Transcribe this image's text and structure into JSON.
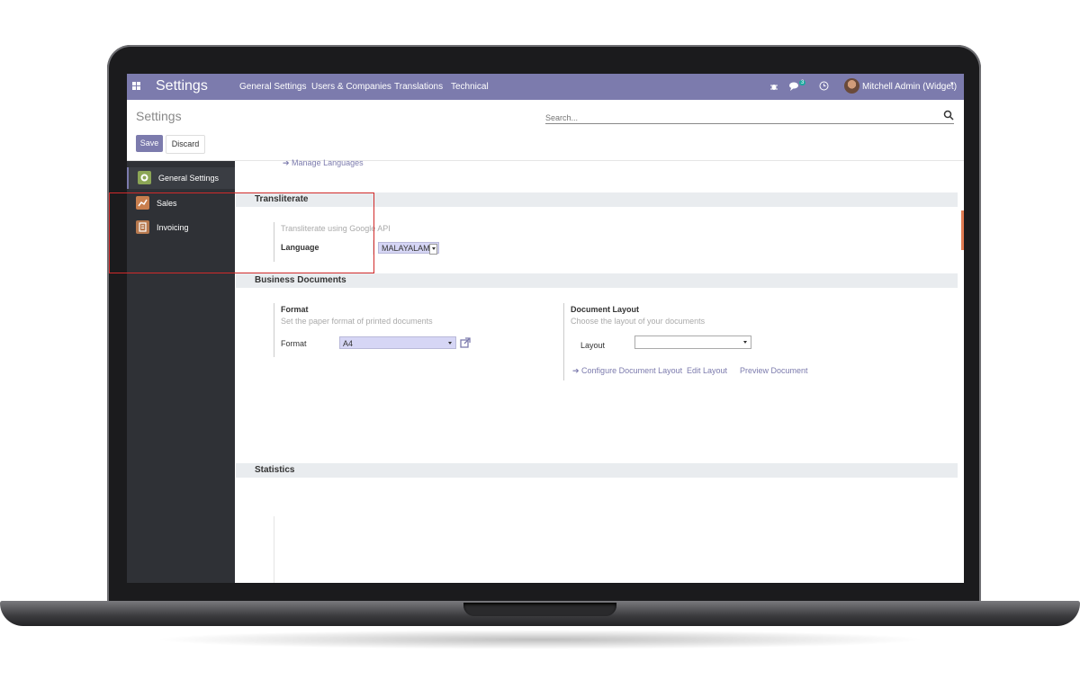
{
  "navbar": {
    "app_title": "Settings",
    "menu": [
      "General Settings",
      "Users & Companies",
      "Translations",
      "Technical"
    ],
    "message_count": "3",
    "user": "Mitchell Admin (Widget)",
    "color": "#7c7bad"
  },
  "control_panel": {
    "breadcrumb": "Settings",
    "search_placeholder": "Search...",
    "save_label": "Save",
    "discard_label": "Discard"
  },
  "sidebar": {
    "items": [
      {
        "label": "General Settings",
        "icon": "gear-icon",
        "active": true
      },
      {
        "label": "Sales",
        "icon": "chart-icon",
        "active": false
      },
      {
        "label": "Invoicing",
        "icon": "invoice-icon",
        "active": false
      }
    ]
  },
  "content": {
    "manage_languages_link": "Manage Languages",
    "transliterate": {
      "title": "Transliterate",
      "description": "Transliterate using Google API",
      "language_label": "Language",
      "language_value": "MALAYALAM"
    },
    "business_documents": {
      "title": "Business Documents",
      "format": {
        "title": "Format",
        "description": "Set the paper format of printed documents",
        "field_label": "Format",
        "field_value": "A4"
      },
      "document_layout": {
        "title": "Document Layout",
        "description": "Choose the layout of your documents",
        "field_label": "Layout",
        "field_value": "",
        "configure_link": "Configure Document Layout",
        "edit_link": "Edit Layout",
        "preview_link": "Preview Document"
      }
    },
    "statistics": {
      "title": "Statistics"
    }
  }
}
